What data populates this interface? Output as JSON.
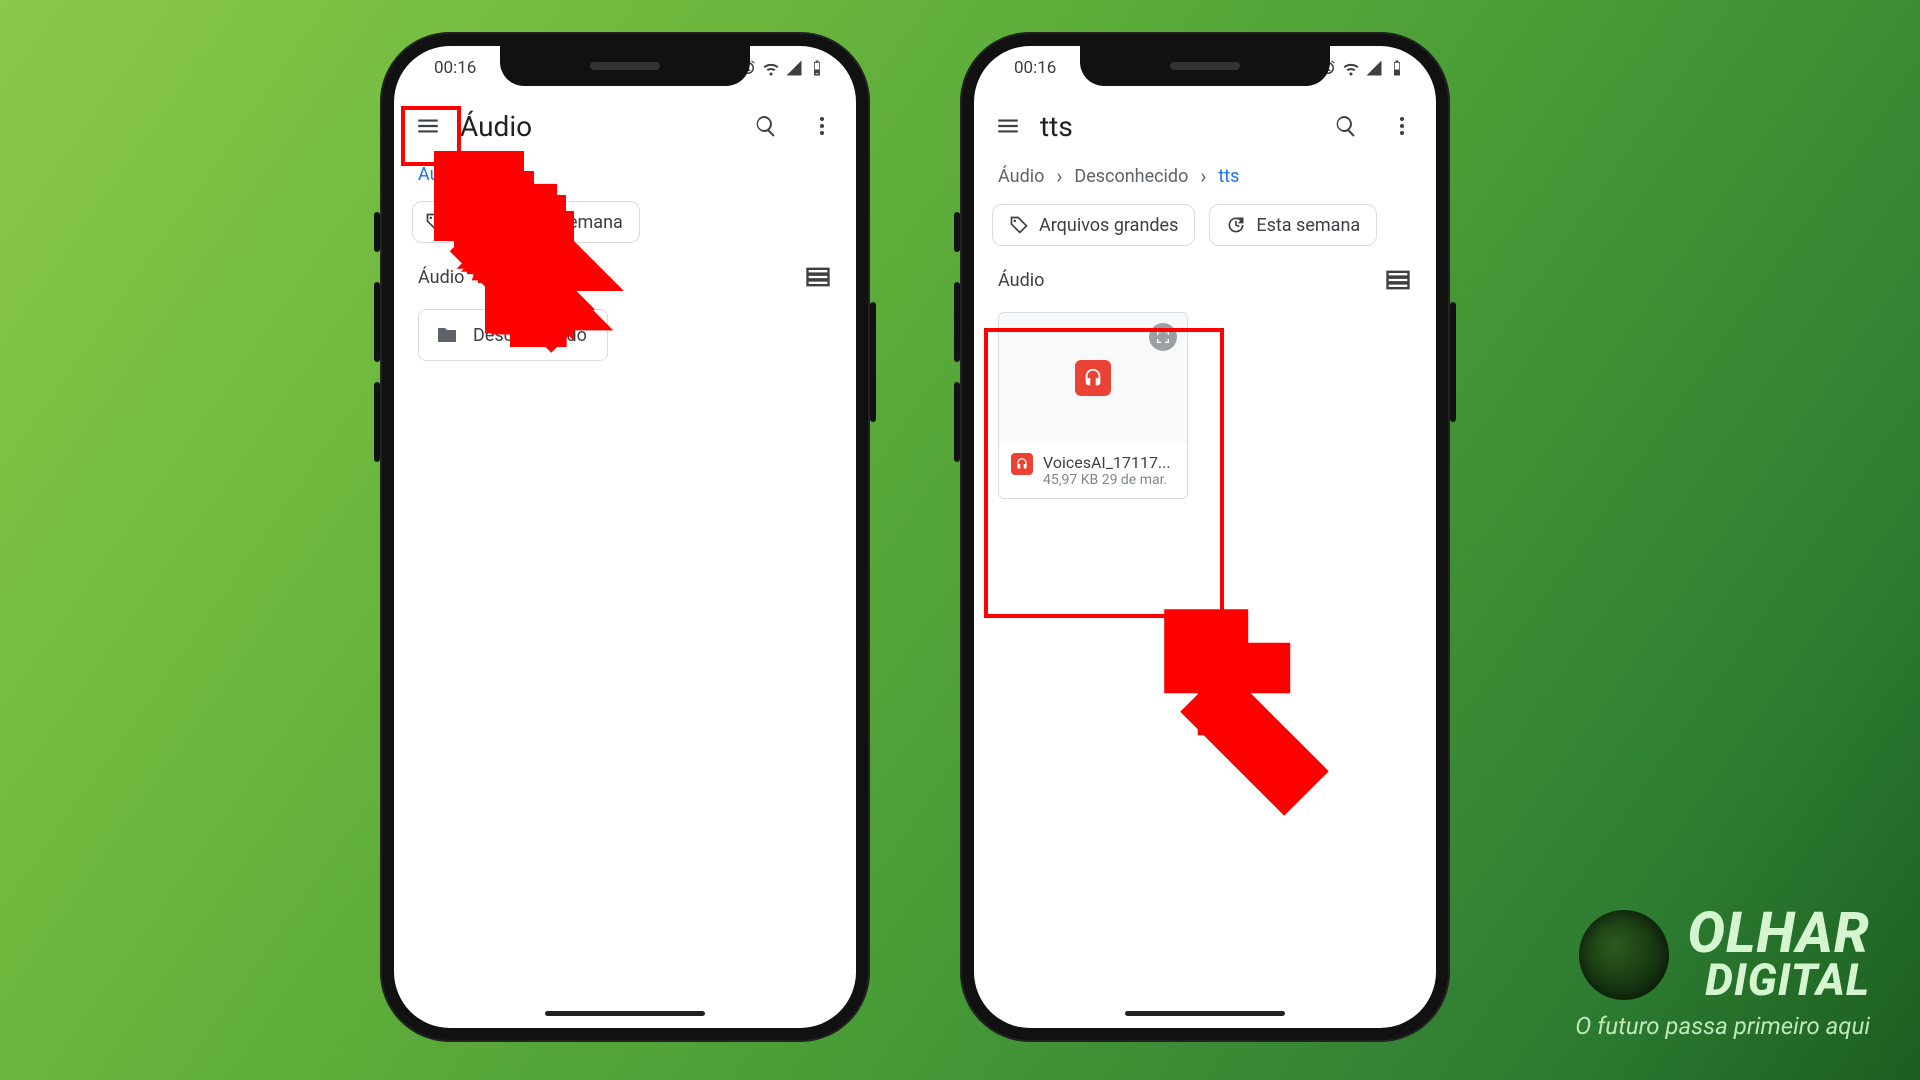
{
  "status_time": "00:16",
  "phone1": {
    "title": "Áudio",
    "breadcrumb": [
      {
        "label": "Áudio",
        "current": true
      }
    ],
    "chips": {
      "large_files": "Arquivos grandes",
      "this_week": "Esta semana"
    },
    "section_label": "Áudio",
    "folder": {
      "name": "Desconhecido"
    }
  },
  "phone2": {
    "title": "tts",
    "breadcrumb": [
      {
        "label": "Áudio",
        "current": false
      },
      {
        "label": "Desconhecido",
        "current": false
      },
      {
        "label": "tts",
        "current": true
      }
    ],
    "chips": {
      "large_files": "Arquivos grandes",
      "this_week": "Esta semana"
    },
    "section_label": "Áudio",
    "file": {
      "name": "VoicesAI_17117...",
      "size": "45,97 KB",
      "date": "29 de mar."
    }
  },
  "brand": {
    "line1": "OLHAR",
    "line2": "DIGITAL",
    "tagline": "O futuro passa primeiro aqui"
  }
}
